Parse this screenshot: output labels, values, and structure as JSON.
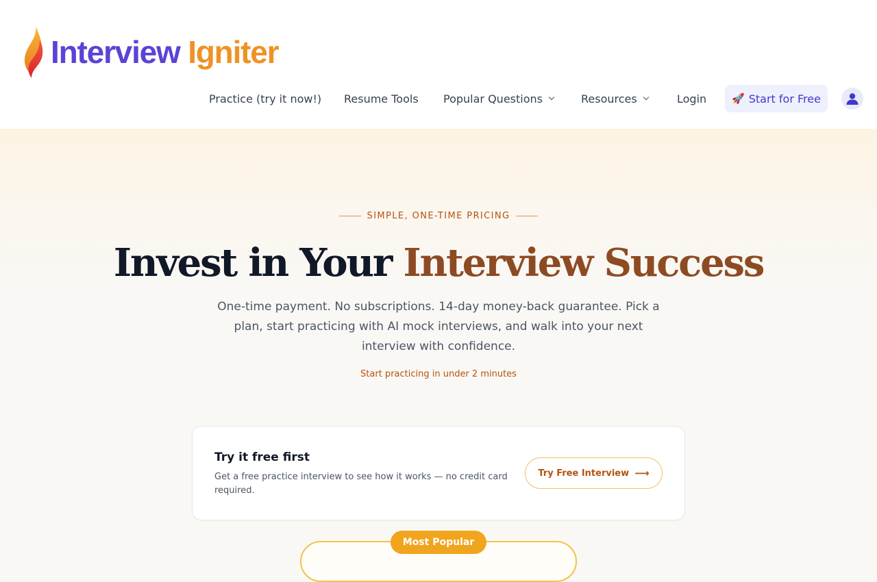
{
  "brand": {
    "name_part1": "Interview",
    "name_part2": "Igniter",
    "icon": "flame-icon",
    "colors": {
      "primary": "#5b43d6",
      "secondary": "#ee9226"
    }
  },
  "nav": {
    "items": [
      {
        "label": "Practice (try it now!)",
        "has_dropdown": false
      },
      {
        "label": "Resume Tools",
        "has_dropdown": false
      },
      {
        "label": "Popular Questions",
        "has_dropdown": true
      },
      {
        "label": "Resources",
        "has_dropdown": true
      },
      {
        "label": "Login",
        "has_dropdown": false
      }
    ],
    "cta": {
      "icon": "🚀",
      "label": "Start for Free"
    },
    "avatar_icon": "user-icon"
  },
  "hero": {
    "eyebrow": "Simple, one-time pricing",
    "headline_part1": "Invest in Your",
    "headline_part2": "Interview Success",
    "subtext": "One-time payment. No subscriptions. 14-day money-back guarantee. Pick a plan, start practicing with AI mock interviews, and walk into your next interview with confidence.",
    "note": "Start practicing in under 2 minutes"
  },
  "free_trial": {
    "title": "Try it free first",
    "description": "Get a free practice interview to see how it works — no credit card required.",
    "button_label": "Try Free Interview",
    "button_icon": "arrow-right-icon"
  },
  "plan": {
    "badge": "Most Popular"
  },
  "colors": {
    "accent_orange": "#b4530d",
    "headline_accent": "#8d4b23",
    "cta_text": "#4338ca",
    "badge_bg": "#f1a51d"
  }
}
